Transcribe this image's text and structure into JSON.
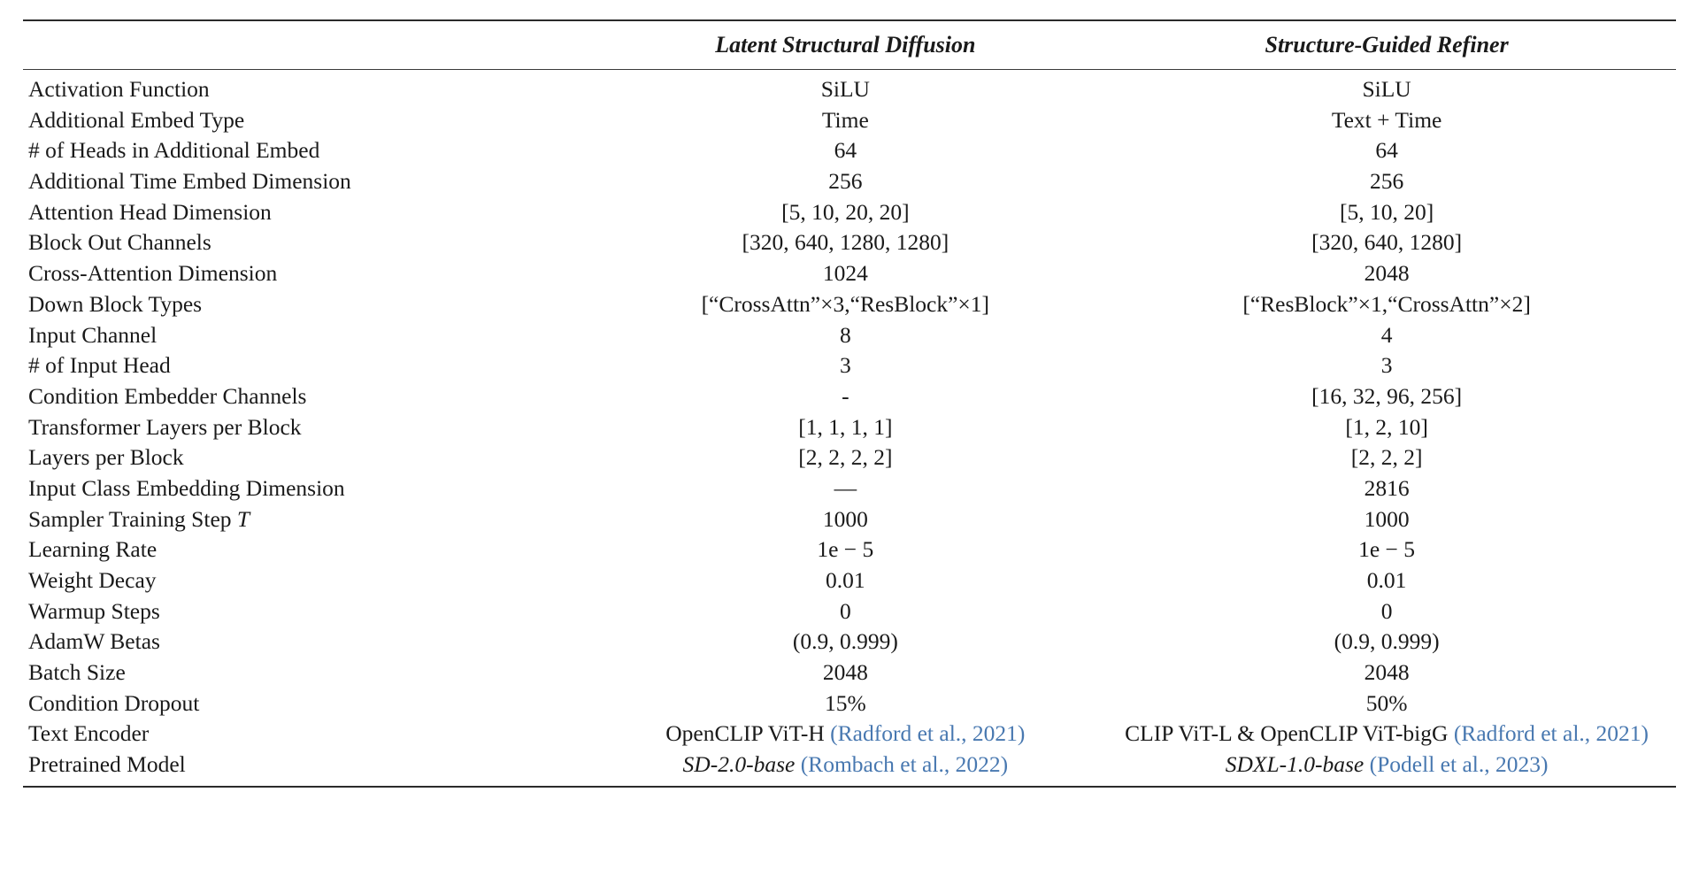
{
  "table": {
    "columns": {
      "row_header": "",
      "col1": "Latent Structural Diffusion",
      "col2": "Structure-Guided Refiner"
    },
    "citation_color": "#4878b0",
    "rows": [
      {
        "label": "Activation Function",
        "col1": "SiLU",
        "col2": "SiLU"
      },
      {
        "label": "Additional Embed Type",
        "col1": "Time",
        "col2": "Text + Time"
      },
      {
        "label": "# of Heads in Additional Embed",
        "col1": "64",
        "col2": "64"
      },
      {
        "label": "Additional Time Embed Dimension",
        "col1": "256",
        "col2": "256"
      },
      {
        "label": "Attention Head Dimension",
        "col1": "[5, 10, 20, 20]",
        "col2": "[5, 10, 20]"
      },
      {
        "label": "Block Out Channels",
        "col1": "[320, 640, 1280, 1280]",
        "col2": "[320, 640, 1280]"
      },
      {
        "label": "Cross-Attention Dimension",
        "col1": "1024",
        "col2": "2048"
      },
      {
        "label": "Down Block Types",
        "col1": "[“CrossAttn”×3,“ResBlock”×1]",
        "col2": "[“ResBlock”×1,“CrossAttn”×2]"
      },
      {
        "label": "Input Channel",
        "col1": "8",
        "col2": "4"
      },
      {
        "label": "# of Input Head",
        "col1": "3",
        "col2": "3"
      },
      {
        "label": "Condition Embedder Channels",
        "col1": "-",
        "col2": "[16, 32, 96, 256]"
      },
      {
        "label": "Transformer Layers per Block",
        "col1": "[1, 1, 1, 1]",
        "col2": "[1, 2, 10]"
      },
      {
        "label": "Layers per Block",
        "col1": "[2, 2, 2, 2]",
        "col2": "[2, 2, 2]"
      },
      {
        "label": "Input Class Embedding Dimension",
        "col1": "—",
        "col2": "2816"
      },
      {
        "label": "Sampler Training Step T",
        "label_plain": "Sampler Training Step",
        "label_italic_suffix": "T",
        "col1": "1000",
        "col2": "1000"
      },
      {
        "label": "Learning Rate",
        "col1": "1e − 5",
        "col2": "1e − 5"
      },
      {
        "label": "Weight Decay",
        "col1": "0.01",
        "col2": "0.01"
      },
      {
        "label": "Warmup Steps",
        "col1": "0",
        "col2": "0"
      },
      {
        "label": "AdamW Betas",
        "col1": "(0.9, 0.999)",
        "col2": "(0.9, 0.999)"
      },
      {
        "label": "Batch Size",
        "col1": "2048",
        "col2": "2048"
      },
      {
        "label": "Condition Dropout",
        "col1": "15%",
        "col2": "50%"
      },
      {
        "label": "Text Encoder",
        "col1_main": "OpenCLIP ViT-H ",
        "col1_cite": "(Radford et al., 2021)",
        "col2_main": "CLIP ViT-L & OpenCLIP ViT-bigG ",
        "col2_cite": "(Radford et al., 2021)"
      },
      {
        "label": "Pretrained Model",
        "col1_main": "SD-2.0-base ",
        "col1_cite": "(Rombach et al., 2022)",
        "col1_italic": true,
        "col2_main": "SDXL-1.0-base ",
        "col2_cite": "(Podell et al., 2023)",
        "col2_italic": true
      }
    ]
  }
}
